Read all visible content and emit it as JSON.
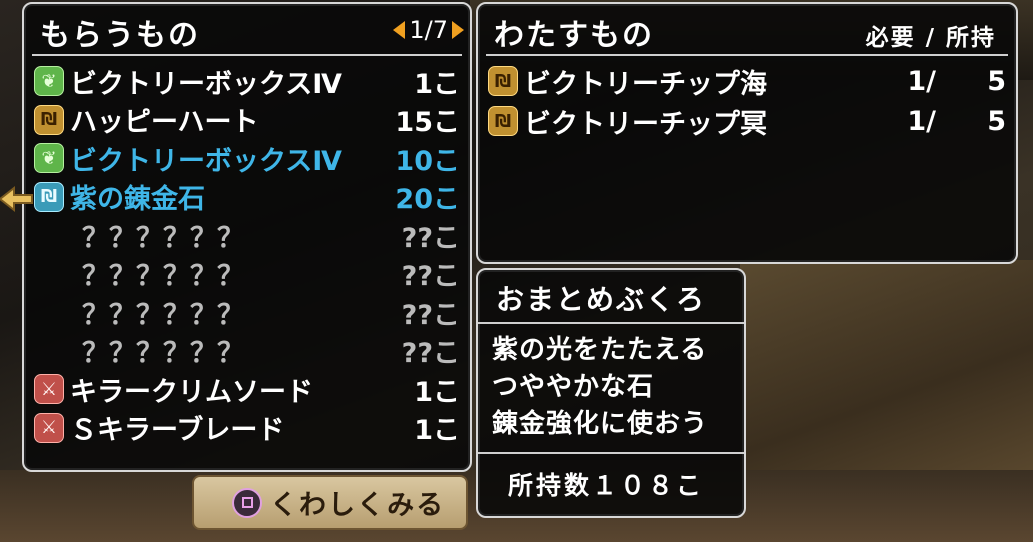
{
  "receive": {
    "title": "もらうもの",
    "page": "1/7",
    "items": [
      {
        "icon": "leaf",
        "name": "ビクトリーボックスⅣ",
        "qty": "1こ",
        "style": "normal"
      },
      {
        "icon": "gold",
        "name": "ハッピーハート",
        "qty": "15こ",
        "style": "normal"
      },
      {
        "icon": "leaf",
        "name": "ビクトリーボックスⅣ",
        "qty": "10こ",
        "style": "highlight"
      },
      {
        "icon": "cyan",
        "name": "紫の錬金石",
        "qty": "20こ",
        "style": "highlight"
      },
      {
        "icon": "none",
        "name": "？？？？？？",
        "qty": "??こ",
        "style": "unknown"
      },
      {
        "icon": "none",
        "name": "？？？？？？",
        "qty": "??こ",
        "style": "unknown"
      },
      {
        "icon": "none",
        "name": "？？？？？？",
        "qty": "??こ",
        "style": "unknown"
      },
      {
        "icon": "none",
        "name": "？？？？？？",
        "qty": "??こ",
        "style": "unknown"
      },
      {
        "icon": "red",
        "name": "キラークリムソード",
        "qty": "1こ",
        "style": "normal"
      },
      {
        "icon": "red",
        "name": "Ｓキラーブレード",
        "qty": "1こ",
        "style": "normal"
      }
    ]
  },
  "give": {
    "title": "わたすもの",
    "header": "必要 / 所持",
    "items": [
      {
        "icon": "gold",
        "name": "ビクトリーチップ海",
        "need": "1/",
        "have": "5"
      },
      {
        "icon": "gold",
        "name": "ビクトリーチップ冥",
        "need": "1/",
        "have": "5"
      }
    ]
  },
  "detail": {
    "title": "おまとめぶくろ",
    "lines": [
      "紫の光をたたえる",
      "つややかな石",
      "錬金強化に使おう"
    ],
    "owned": "所持数１０８こ"
  },
  "action": {
    "label": "くわしくみる"
  },
  "colors": {
    "highlight": "#3fb6e8",
    "frame": "#d8d8d8",
    "accent": "#f0a020"
  }
}
